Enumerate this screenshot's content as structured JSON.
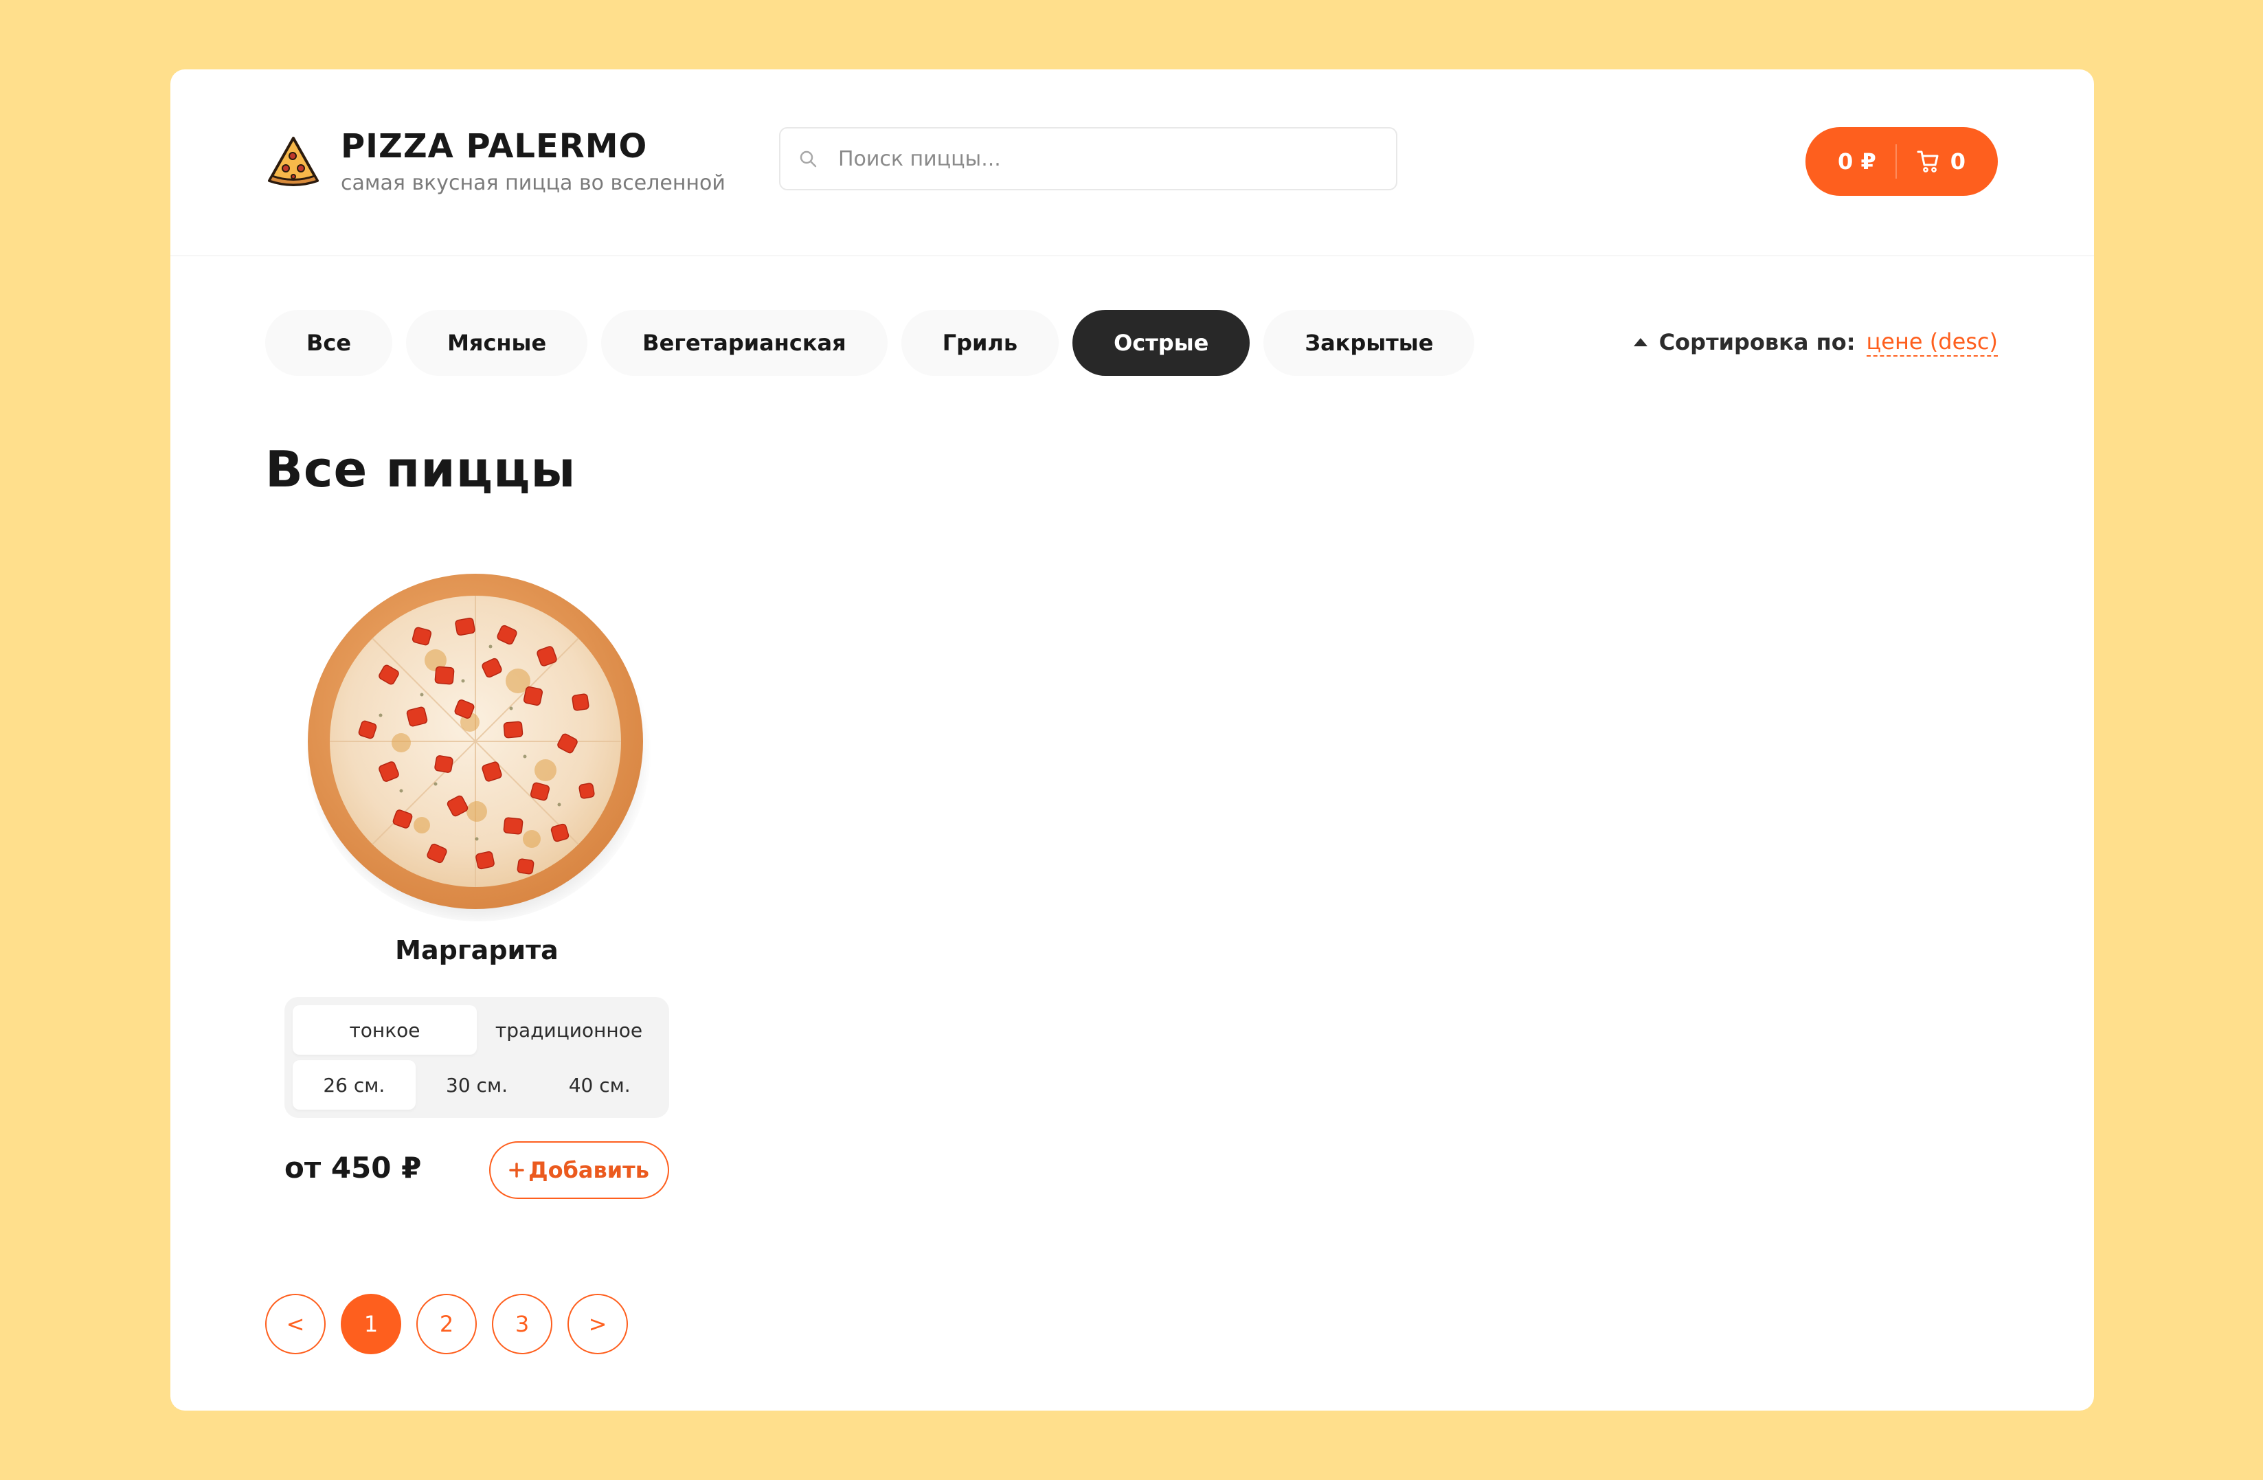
{
  "header": {
    "title": "PIZZA PALERMO",
    "subtitle": "самая вкусная пицца во вселенной",
    "search_placeholder": "Поиск пиццы...",
    "cart": {
      "total": "0 ₽",
      "count": "0"
    }
  },
  "categories": {
    "items": [
      {
        "label": "Все"
      },
      {
        "label": "Мясные"
      },
      {
        "label": "Вегетарианская"
      },
      {
        "label": "Гриль"
      },
      {
        "label": "Острые"
      },
      {
        "label": "Закрытые"
      }
    ],
    "active": "Острые"
  },
  "sort": {
    "label": "Сортировка по:",
    "value": "цене (desc)"
  },
  "page_title": "Все пиццы",
  "pizzas": [
    {
      "name": "Маргарита",
      "dough_types": [
        "тонкое",
        "традиционное"
      ],
      "active_dough": "тонкое",
      "sizes": [
        "26 см.",
        "30 см.",
        "40 см."
      ],
      "active_size": "26 см.",
      "price": "от 450 ₽",
      "add_label": "Добавить"
    }
  ],
  "pagination": {
    "prev": "<",
    "pages": [
      "1",
      "2",
      "3"
    ],
    "active": "1",
    "next": ">"
  },
  "colors": {
    "background": "#ffdf8c",
    "accent": "#fe5f1e",
    "active_category": "#282828"
  },
  "icons": {
    "logo": "pizza-slice-icon",
    "search": "search-icon",
    "cart": "shopping-cart-icon",
    "sort": "triangle-up-icon",
    "add": "plus-icon"
  }
}
